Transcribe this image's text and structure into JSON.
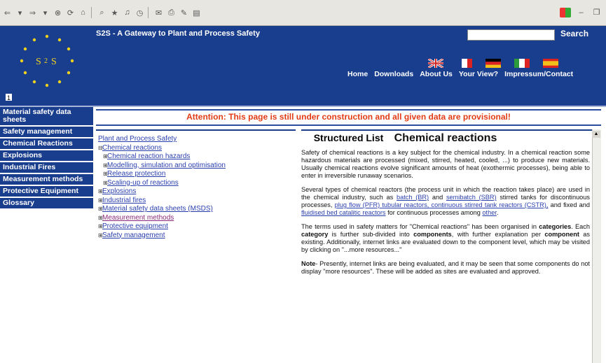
{
  "header": {
    "site_title": "S2S - A Gateway to Plant and Process Safety",
    "search_label": "Search"
  },
  "nav": [
    "Home",
    "Downloads",
    "About Us",
    "Your View?",
    "Impressum/Contact"
  ],
  "sidebar": {
    "items": [
      {
        "label": "Material safety data sheets"
      },
      {
        "label": "Safety management"
      },
      {
        "label": "Chemical Reactions"
      },
      {
        "label": "Explosions"
      },
      {
        "label": "Industrial Fires"
      },
      {
        "label": "Measurement methods"
      },
      {
        "label": "Protective Equipment"
      },
      {
        "label": "Glossary"
      }
    ]
  },
  "attention": "Attention: This page is still under construction and all given data are provisional!",
  "structured_title": "Structured List",
  "tree": {
    "root": "Plant and Process Safety",
    "items": [
      {
        "label": "Chemical reactions",
        "level": 1,
        "marker": "⊟"
      },
      {
        "label": "Chemical reaction hazards",
        "level": 2,
        "marker": "⊞"
      },
      {
        "label": "Modelling, simulation and optimisation",
        "level": 2,
        "marker": "⊞"
      },
      {
        "label": "Release protection",
        "level": 2,
        "marker": "⊞"
      },
      {
        "label": "Scaling-up of reactions",
        "level": 2,
        "marker": "⊞"
      },
      {
        "label": "Explosions",
        "level": 1,
        "marker": "⊞"
      },
      {
        "label": "Industrial fires",
        "level": 1,
        "marker": "⊞"
      },
      {
        "label": "Material safety data sheets (MSDS)",
        "level": 1,
        "marker": "⊞"
      },
      {
        "label": "Measurement methods",
        "level": 1,
        "marker": "⊞"
      },
      {
        "label": "Protective equipment",
        "level": 1,
        "marker": "⊞"
      },
      {
        "label": "Safety management",
        "level": 1,
        "marker": "⊞"
      }
    ]
  },
  "content": {
    "title": "Chemical reactions",
    "p1": "Safety of chemical reactions is a key subject for the chemical industry. In a chemical reaction some hazardous materials are processed (mixed, stirred, heated, cooled, ...) to produce new materials. Usually chemical reactions evolve significant amounts of heat (exothermic processes), being able to enter in irreversible runaway scenarios.",
    "p2": {
      "t1": "Several types of chemical reactors (the process unit in which the reaction takes place) are used in the chemical industry, such as ",
      "l1": "batch (BR)",
      "t2": " and ",
      "l2": "semibatch (SBR)",
      "t3": " stirred tanks for discontinuous processes, ",
      "l3": "plug flow (PFR) tubular reactors, continuous stirred tank reactors (CSTR),",
      "t4": " and fixed and ",
      "l4": "fluidised bed catalitic reactors",
      "t5": " for continuous processes among ",
      "l5": "other",
      "t6": "."
    },
    "p3": {
      "t1": "The terms used in safety matters for \"Chemical reactions\" has been organised in ",
      "b1": "categories",
      "t2": ". Each ",
      "b2": "category",
      "t3": " is further sub-divided into ",
      "b3": "components",
      "t4": ", with further explanation per ",
      "b4": "component",
      "t5": " as existing.  Additionally, internet links are evaluated down to the component level, which may be visited by clicking on \"...more resources...\""
    },
    "p4": {
      "b1": "Note",
      "t1": "- Presently, internet links are being evaluated, and it may be seen that some components do not display \"more resources\".  These will be added as sites are evaluated and approved."
    }
  },
  "colors": {
    "brand_blue": "#1a3e8e",
    "attention": "#e23b15",
    "link": "#2a3fae"
  }
}
